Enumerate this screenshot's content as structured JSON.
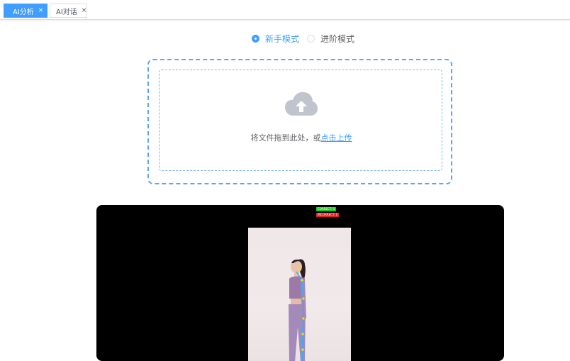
{
  "tabs": [
    {
      "label": "AI分析",
      "active": true
    },
    {
      "label": "AI对话",
      "active": false
    }
  ],
  "modes": [
    {
      "label": "新手模式",
      "checked": true
    },
    {
      "label": "进阶模式",
      "checked": false
    }
  ],
  "upload": {
    "prompt": "将文件拖到此处，或",
    "link": "点击上传"
  },
  "video": {
    "correct_label": "CORRECT: 0",
    "incorrect_label": "INCORRECT: 0"
  },
  "colors": {
    "accent": "#409eff",
    "correct": "#1ec41e",
    "incorrect": "#e02020"
  }
}
